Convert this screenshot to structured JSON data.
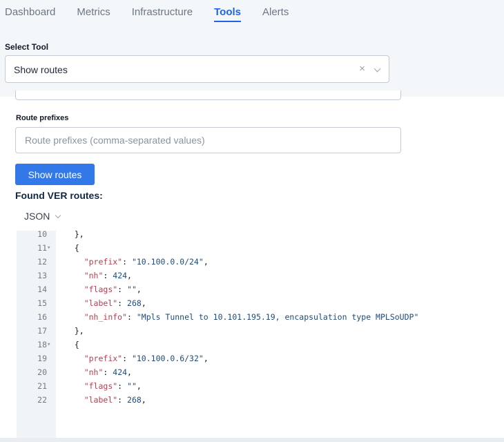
{
  "nav": {
    "tabs": [
      "Dashboard",
      "Metrics",
      "Infrastructure",
      "Tools",
      "Alerts"
    ],
    "active": "Tools"
  },
  "tool_select": {
    "label": "Select Tool",
    "value": "Show routes",
    "clear_glyph": "×"
  },
  "form": {
    "route_prefixes_label": "Route prefixes",
    "route_prefixes_placeholder": "Route prefixes (comma-separated values)",
    "route_prefixes_value": "",
    "submit_label": "Show routes"
  },
  "results": {
    "heading": "Found VER routes:",
    "format": "JSON"
  },
  "code_lines": [
    {
      "num": "10",
      "fold": "",
      "text": "  },"
    },
    {
      "num": "11",
      "fold": "▾",
      "text": "  {"
    },
    {
      "num": "12",
      "fold": "",
      "key": "prefix",
      "val": "\"10.100.0.0/24\"",
      "tail": ","
    },
    {
      "num": "13",
      "fold": "",
      "key": "nh",
      "val": "424",
      "tail": ","
    },
    {
      "num": "14",
      "fold": "",
      "key": "flags",
      "val": "\"\"",
      "tail": ","
    },
    {
      "num": "15",
      "fold": "",
      "key": "label",
      "val": "268",
      "tail": ","
    },
    {
      "num": "16",
      "fold": "",
      "key": "nh_info",
      "val": "\"Mpls Tunnel to 10.101.195.19, encapsulation type MPLSoUDP\"",
      "tail": ""
    },
    {
      "num": "17",
      "fold": "",
      "text": "  },"
    },
    {
      "num": "18",
      "fold": "▾",
      "text": "  {"
    },
    {
      "num": "19",
      "fold": "",
      "key": "prefix",
      "val": "\"10.100.0.6/32\"",
      "tail": ","
    },
    {
      "num": "20",
      "fold": "",
      "key": "nh",
      "val": "424",
      "tail": ","
    },
    {
      "num": "21",
      "fold": "",
      "key": "flags",
      "val": "\"\"",
      "tail": ","
    },
    {
      "num": "22",
      "fold": "",
      "key": "label",
      "val": "268",
      "tail": ","
    }
  ],
  "colors": {
    "accent": "#1e63e9",
    "button": "#3278e8",
    "json_key": "#b83c4f",
    "json_value": "#1e4b7a"
  }
}
